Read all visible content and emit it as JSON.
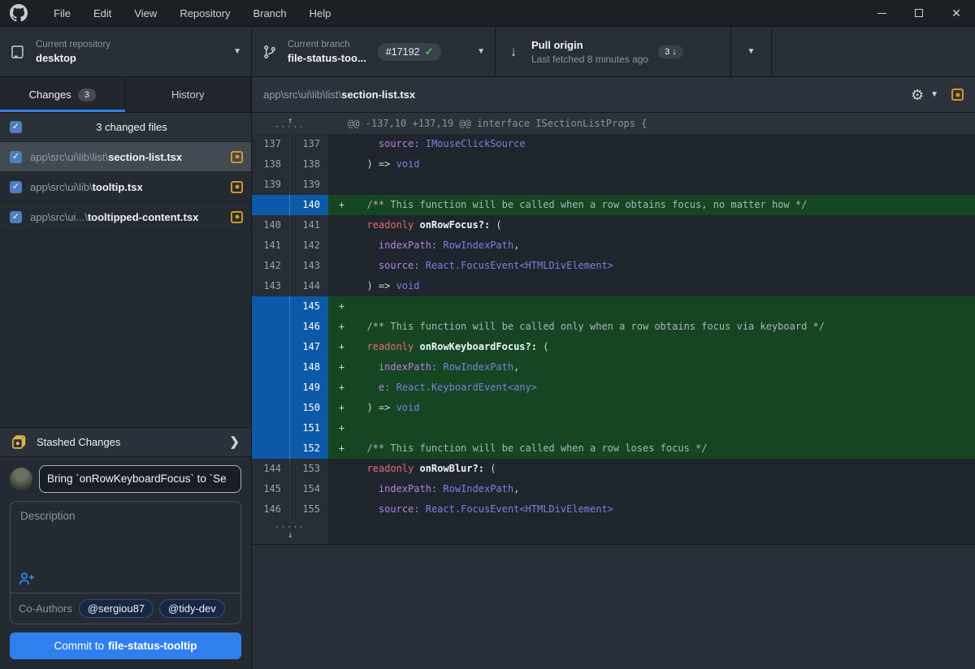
{
  "titlebar": {
    "menu_items": [
      "File",
      "Edit",
      "View",
      "Repository",
      "Branch",
      "Help"
    ],
    "window_controls": [
      "minimize",
      "maximize",
      "close"
    ]
  },
  "toolbar": {
    "repository": {
      "label": "Current repository",
      "value": "desktop"
    },
    "branch": {
      "label": "Current branch",
      "value": "file-status-too...",
      "badge": "#17192"
    },
    "pull": {
      "title": "Pull origin",
      "subtitle": "Last fetched 8 minutes ago",
      "badge_count": "3"
    }
  },
  "sidebar": {
    "tabs": [
      {
        "label": "Changes",
        "badge": "3",
        "active": true
      },
      {
        "label": "History",
        "active": false
      }
    ],
    "include_all_label": "3 changed files",
    "files": [
      {
        "dir": "app\\src\\ui\\lib\\list\\",
        "name": "section-list.tsx",
        "status": "modified",
        "checked": true,
        "selected": true
      },
      {
        "dir": "app\\src\\ui\\lib\\",
        "name": "tooltip.tsx",
        "status": "modified",
        "checked": true,
        "selected": false
      },
      {
        "dir": "app\\src\\ui...\\",
        "name": "tooltipped-content.tsx",
        "status": "modified",
        "checked": true,
        "selected": false
      }
    ],
    "stashed_changes_label": "Stashed Changes",
    "commit": {
      "summary_value": "Bring `onRowKeyboardFocus` to `Se",
      "description_placeholder": "Description",
      "coauthors_label": "Co-Authors",
      "coauthors": [
        "@sergiou87",
        "@tidy-dev"
      ],
      "button_prefix": "Commit to",
      "button_branch": "file-status-tooltip"
    }
  },
  "diff": {
    "file_path_dir": "app\\src\\ui\\lib\\list\\",
    "file_name": "section-list.tsx",
    "rows": [
      {
        "type": "hunk",
        "text": "@@ -137,10 +137,19 @@ interface ISectionListProps {"
      },
      {
        "type": "context",
        "old": "137",
        "new": "137",
        "code": [
          {
            "t": "    ",
            "c": "plain"
          },
          {
            "t": "source:",
            "c": "purple"
          },
          {
            "t": " ",
            "c": "plain"
          },
          {
            "t": "IMouseClickSource",
            "c": "indigo"
          }
        ]
      },
      {
        "type": "context",
        "old": "138",
        "new": "138",
        "code": [
          {
            "t": "  ) => ",
            "c": "plain"
          },
          {
            "t": "void",
            "c": "indigo"
          }
        ]
      },
      {
        "type": "context",
        "old": "139",
        "new": "139",
        "code": []
      },
      {
        "type": "add",
        "old": "",
        "new": "140",
        "code": [
          {
            "t": "  ",
            "c": "plain"
          },
          {
            "t": "/** This function will be called when a row obtains focus, no matter how */",
            "c": "comment"
          }
        ]
      },
      {
        "type": "context",
        "old": "140",
        "new": "141",
        "code": [
          {
            "t": "  ",
            "c": "plain"
          },
          {
            "t": "readonly ",
            "c": "red"
          },
          {
            "t": "onRowFocus?:",
            "c": "bold"
          },
          {
            "t": " (",
            "c": "plain"
          }
        ]
      },
      {
        "type": "context",
        "old": "141",
        "new": "142",
        "code": [
          {
            "t": "    ",
            "c": "plain"
          },
          {
            "t": "indexPath:",
            "c": "purple"
          },
          {
            "t": " ",
            "c": "plain"
          },
          {
            "t": "RowIndexPath",
            "c": "indigo"
          },
          {
            "t": ",",
            "c": "plain"
          }
        ]
      },
      {
        "type": "context",
        "old": "142",
        "new": "143",
        "code": [
          {
            "t": "    ",
            "c": "plain"
          },
          {
            "t": "source:",
            "c": "purple"
          },
          {
            "t": " ",
            "c": "plain"
          },
          {
            "t": "React.FocusEvent<HTMLDivElement>",
            "c": "indigo"
          }
        ]
      },
      {
        "type": "context",
        "old": "143",
        "new": "144",
        "code": [
          {
            "t": "  ) => ",
            "c": "plain"
          },
          {
            "t": "void",
            "c": "indigo"
          }
        ]
      },
      {
        "type": "add",
        "old": "",
        "new": "145",
        "code": []
      },
      {
        "type": "add",
        "old": "",
        "new": "146",
        "code": [
          {
            "t": "  ",
            "c": "plain"
          },
          {
            "t": "/** This function will be called only when a row obtains focus via keyboard */",
            "c": "comment"
          }
        ]
      },
      {
        "type": "add",
        "old": "",
        "new": "147",
        "code": [
          {
            "t": "  ",
            "c": "plain"
          },
          {
            "t": "readonly ",
            "c": "red"
          },
          {
            "t": "onRowKeyboardFocus?:",
            "c": "bold"
          },
          {
            "t": " (",
            "c": "plain"
          }
        ]
      },
      {
        "type": "add",
        "old": "",
        "new": "148",
        "code": [
          {
            "t": "    ",
            "c": "plain"
          },
          {
            "t": "indexPath:",
            "c": "purple"
          },
          {
            "t": " ",
            "c": "plain"
          },
          {
            "t": "RowIndexPath",
            "c": "indigo"
          },
          {
            "t": ",",
            "c": "plain"
          }
        ]
      },
      {
        "type": "add",
        "old": "",
        "new": "149",
        "code": [
          {
            "t": "    ",
            "c": "plain"
          },
          {
            "t": "e:",
            "c": "purple"
          },
          {
            "t": " ",
            "c": "plain"
          },
          {
            "t": "React.KeyboardEvent<any>",
            "c": "indigo"
          }
        ]
      },
      {
        "type": "add",
        "old": "",
        "new": "150",
        "code": [
          {
            "t": "  ) => ",
            "c": "plain"
          },
          {
            "t": "void",
            "c": "indigo"
          }
        ]
      },
      {
        "type": "add",
        "old": "",
        "new": "151",
        "code": []
      },
      {
        "type": "add",
        "old": "",
        "new": "152",
        "code": [
          {
            "t": "  ",
            "c": "plain"
          },
          {
            "t": "/** This function will be called when a row loses focus */",
            "c": "comment"
          }
        ]
      },
      {
        "type": "context",
        "old": "144",
        "new": "153",
        "code": [
          {
            "t": "  ",
            "c": "plain"
          },
          {
            "t": "readonly ",
            "c": "red"
          },
          {
            "t": "onRowBlur?:",
            "c": "bold"
          },
          {
            "t": " (",
            "c": "plain"
          }
        ]
      },
      {
        "type": "context",
        "old": "145",
        "new": "154",
        "code": [
          {
            "t": "    ",
            "c": "plain"
          },
          {
            "t": "indexPath:",
            "c": "purple"
          },
          {
            "t": " ",
            "c": "plain"
          },
          {
            "t": "RowIndexPath",
            "c": "indigo"
          },
          {
            "t": ",",
            "c": "plain"
          }
        ]
      },
      {
        "type": "context",
        "old": "146",
        "new": "155",
        "code": [
          {
            "t": "    ",
            "c": "plain"
          },
          {
            "t": "source:",
            "c": "purple"
          },
          {
            "t": " ",
            "c": "plain"
          },
          {
            "t": "React.FocusEvent<HTMLDivElement>",
            "c": "indigo"
          }
        ]
      },
      {
        "type": "expand-down"
      }
    ]
  },
  "colors": {
    "accent_blue": "#2f80ed",
    "addition_row_bg": "#164522",
    "added_gutter_bg": "#0d59a9",
    "modified_yellow": "#d29922",
    "check_green": "#4ac26b"
  }
}
